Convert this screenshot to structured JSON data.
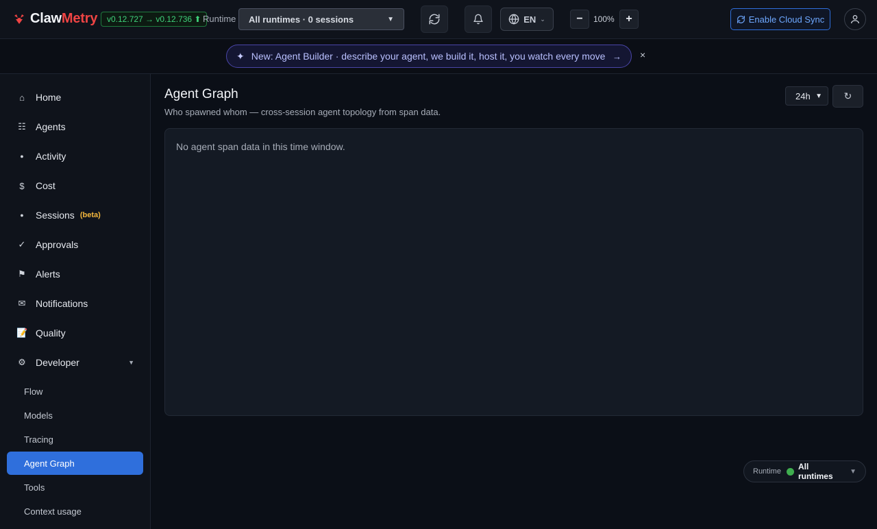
{
  "header": {
    "logo_part1": "Claw",
    "logo_part2": "Metry",
    "version": "v0.12.727 → v0.12.736 ⬆",
    "runtime_label": "Runtime",
    "runtime_select": "All runtimes · 0 sessions",
    "language": "EN",
    "zoom": "100%",
    "zoom_out": "−",
    "zoom_in": "+",
    "cloud_sync": "Enable Cloud Sync",
    "icons": [
      "refresh-icon",
      "bell-icon",
      "globe-icon",
      "user-icon"
    ]
  },
  "announcement": {
    "text": "New: Agent Builder · describe your agent, we build it, host it, you watch every move",
    "arrow": "→",
    "close": "×"
  },
  "sidebar": {
    "items": [
      {
        "icon": "⌂",
        "label": "Home"
      },
      {
        "icon": "☷",
        "label": "Agents"
      },
      {
        "icon": "●",
        "label": "Activity"
      },
      {
        "icon": "$",
        "label": "Cost"
      },
      {
        "icon": "●",
        "label": "Sessions",
        "badge": "(beta)"
      },
      {
        "icon": "✓",
        "label": "Approvals"
      },
      {
        "icon": "⚑",
        "label": "Alerts"
      },
      {
        "icon": "✉",
        "label": "Notifications"
      },
      {
        "icon": "📝",
        "label": "Quality"
      },
      {
        "icon": "⚙",
        "label": "Developer",
        "caret": "▼"
      }
    ],
    "sub_items": [
      "Flow",
      "Models",
      "Tracing",
      "Agent Graph",
      "Tools",
      "Context usage"
    ],
    "active_sub": "Agent Graph"
  },
  "main": {
    "title": "Agent Graph",
    "subtitle": "Who spawned whom — cross-session agent topology from span data.",
    "range": "24h",
    "refresh": "↻",
    "empty_message": "No agent span data in this time window."
  },
  "runtime_pill": {
    "label": "Runtime",
    "value": "All runtimes",
    "status_color": "#3fae4f"
  },
  "colors": {
    "accent": "#2f6fdc",
    "brand_red": "#ef4444",
    "version_green": "#3fd17a",
    "beta_yellow": "#f5b83d"
  }
}
